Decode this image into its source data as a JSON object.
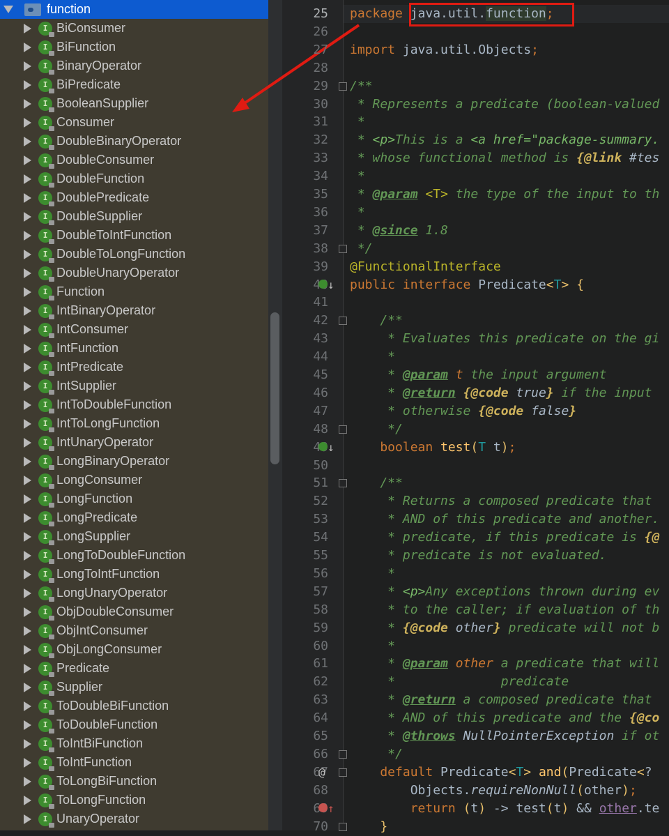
{
  "tree": {
    "package": "function",
    "interface_badge": "I",
    "items": [
      "BiConsumer",
      "BiFunction",
      "BinaryOperator",
      "BiPredicate",
      "BooleanSupplier",
      "Consumer",
      "DoubleBinaryOperator",
      "DoubleConsumer",
      "DoubleFunction",
      "DoublePredicate",
      "DoubleSupplier",
      "DoubleToIntFunction",
      "DoubleToLongFunction",
      "DoubleUnaryOperator",
      "Function",
      "IntBinaryOperator",
      "IntConsumer",
      "IntFunction",
      "IntPredicate",
      "IntSupplier",
      "IntToDoubleFunction",
      "IntToLongFunction",
      "IntUnaryOperator",
      "LongBinaryOperator",
      "LongConsumer",
      "LongFunction",
      "LongPredicate",
      "LongSupplier",
      "LongToDoubleFunction",
      "LongToIntFunction",
      "LongUnaryOperator",
      "ObjDoubleConsumer",
      "ObjIntConsumer",
      "ObjLongConsumer",
      "Predicate",
      "Supplier",
      "ToDoubleBiFunction",
      "ToDoubleFunction",
      "ToIntBiFunction",
      "ToIntFunction",
      "ToLongBiFunction",
      "ToLongFunction",
      "UnaryOperator"
    ]
  },
  "editor": {
    "current_line": 25,
    "first_line": 25,
    "gutter_marks": {
      "40": "implemented-icon",
      "49": "implemented-icon",
      "67": "@",
      "69": "lambda-icon"
    },
    "lines": [
      [
        [
          "kw",
          "package "
        ],
        [
          "pl",
          "java.util."
        ],
        [
          "hl",
          "function"
        ],
        [
          "kw",
          ";"
        ]
      ],
      [],
      [
        [
          "kw",
          "import "
        ],
        [
          "pl",
          "java.util.Objects"
        ],
        [
          "kw",
          ";"
        ]
      ],
      [],
      [
        [
          "cm",
          "/**"
        ]
      ],
      [
        [
          "cm",
          " * Represents a predicate (boolean-valued"
        ]
      ],
      [
        [
          "cm",
          " *"
        ]
      ],
      [
        [
          "cm",
          " * "
        ],
        [
          "ctag",
          "<p>"
        ],
        [
          "cm",
          "This is a "
        ],
        [
          "ctag",
          "<a href=\"package-summary."
        ]
      ],
      [
        [
          "cm",
          " * whose functional method is "
        ],
        [
          "ci",
          "{@link"
        ],
        [
          "cm",
          " "
        ],
        [
          "cp",
          "#tes"
        ]
      ],
      [
        [
          "cm",
          " *"
        ]
      ],
      [
        [
          "cm",
          " * "
        ],
        [
          "tag",
          "@param"
        ],
        [
          "cm",
          " "
        ],
        [
          "ann",
          "<T>"
        ],
        [
          "cm",
          " the type of the input to th"
        ]
      ],
      [
        [
          "cm",
          " *"
        ]
      ],
      [
        [
          "cm",
          " * "
        ],
        [
          "tag",
          "@since"
        ],
        [
          "cm",
          " 1.8"
        ]
      ],
      [
        [
          "cm",
          " */"
        ]
      ],
      [
        [
          "ann",
          "@FunctionalInterface"
        ]
      ],
      [
        [
          "kw",
          "public interface "
        ],
        [
          "pl",
          "Predicate"
        ],
        [
          "br",
          "<"
        ],
        [
          "tp",
          "T"
        ],
        [
          "br",
          "> {"
        ]
      ],
      [],
      [
        [
          "cm",
          "    /**"
        ]
      ],
      [
        [
          "cm",
          "     * Evaluates this predicate on the gi"
        ]
      ],
      [
        [
          "cm",
          "     *"
        ]
      ],
      [
        [
          "cm",
          "     * "
        ],
        [
          "tag",
          "@param"
        ],
        [
          "cm",
          " "
        ],
        [
          "kw2",
          "t"
        ],
        [
          "cm",
          " the input argument"
        ]
      ],
      [
        [
          "cm",
          "     * "
        ],
        [
          "tag",
          "@return"
        ],
        [
          "cm",
          " "
        ],
        [
          "ci",
          "{@code"
        ],
        [
          "cp",
          " true"
        ],
        [
          "ci",
          "}"
        ],
        [
          "cm",
          " if the input "
        ]
      ],
      [
        [
          "cm",
          "     * otherwise "
        ],
        [
          "ci",
          "{@code"
        ],
        [
          "cp",
          " false"
        ],
        [
          "ci",
          "}"
        ]
      ],
      [
        [
          "cm",
          "     */"
        ]
      ],
      [
        [
          "kw",
          "    boolean "
        ],
        [
          "y",
          "test"
        ],
        [
          "br",
          "("
        ],
        [
          "tp",
          "T"
        ],
        [
          "pl",
          " t"
        ],
        [
          "br",
          ")"
        ],
        [
          "kw",
          ";"
        ]
      ],
      [],
      [
        [
          "cm",
          "    /**"
        ]
      ],
      [
        [
          "cm",
          "     * Returns a composed predicate that "
        ]
      ],
      [
        [
          "cm",
          "     * AND of this predicate and another."
        ]
      ],
      [
        [
          "cm",
          "     * predicate, if this predicate is "
        ],
        [
          "ci",
          "{@"
        ]
      ],
      [
        [
          "cm",
          "     * predicate is not evaluated."
        ]
      ],
      [
        [
          "cm",
          "     *"
        ]
      ],
      [
        [
          "cm",
          "     * "
        ],
        [
          "ctag",
          "<p>"
        ],
        [
          "cm",
          "Any exceptions thrown during ev"
        ]
      ],
      [
        [
          "cm",
          "     * to the caller; if evaluation of th"
        ]
      ],
      [
        [
          "cm",
          "     * "
        ],
        [
          "ci",
          "{@code"
        ],
        [
          "cp",
          " other"
        ],
        [
          "ci",
          "}"
        ],
        [
          "cm",
          " predicate will not b"
        ]
      ],
      [
        [
          "cm",
          "     *"
        ]
      ],
      [
        [
          "cm",
          "     * "
        ],
        [
          "tag",
          "@param"
        ],
        [
          "cm",
          " "
        ],
        [
          "kw2",
          "other"
        ],
        [
          "cm",
          " a predicate that will"
        ]
      ],
      [
        [
          "cm",
          "     *              predicate"
        ]
      ],
      [
        [
          "cm",
          "     * "
        ],
        [
          "tag",
          "@return"
        ],
        [
          "cm",
          " a composed predicate that "
        ]
      ],
      [
        [
          "cm",
          "     * AND of this predicate and the "
        ],
        [
          "ci",
          "{@co"
        ]
      ],
      [
        [
          "cm",
          "     * "
        ],
        [
          "tag",
          "@throws"
        ],
        [
          "cm",
          " "
        ],
        [
          "cp",
          "NullPointerException"
        ],
        [
          "cm",
          " if ot"
        ]
      ],
      [
        [
          "cm",
          "     */"
        ]
      ],
      [
        [
          "kw",
          "    default "
        ],
        [
          "pl",
          "Predicate"
        ],
        [
          "br",
          "<"
        ],
        [
          "tp",
          "T"
        ],
        [
          "br",
          "> "
        ],
        [
          "y",
          "and"
        ],
        [
          "br",
          "("
        ],
        [
          "pl",
          "Predicate"
        ],
        [
          "br",
          "<"
        ],
        [
          "pl",
          "? "
        ]
      ],
      [
        [
          "pl",
          "        Objects."
        ],
        [
          "it",
          "requireNonNull"
        ],
        [
          "br",
          "("
        ],
        [
          "pl",
          "other"
        ],
        [
          "br",
          ")"
        ],
        [
          "kw",
          ";"
        ]
      ],
      [
        [
          "kw",
          "        return "
        ],
        [
          "br",
          "("
        ],
        [
          "pl",
          "t"
        ],
        [
          "br",
          ")"
        ],
        [
          "pl",
          " -> test"
        ],
        [
          "br",
          "("
        ],
        [
          "pl",
          "t"
        ],
        [
          "br",
          ")"
        ],
        [
          "pl",
          " && "
        ],
        [
          "pu",
          "other"
        ],
        [
          "pl",
          ".te"
        ]
      ],
      [
        [
          "br",
          "    }"
        ]
      ]
    ]
  }
}
